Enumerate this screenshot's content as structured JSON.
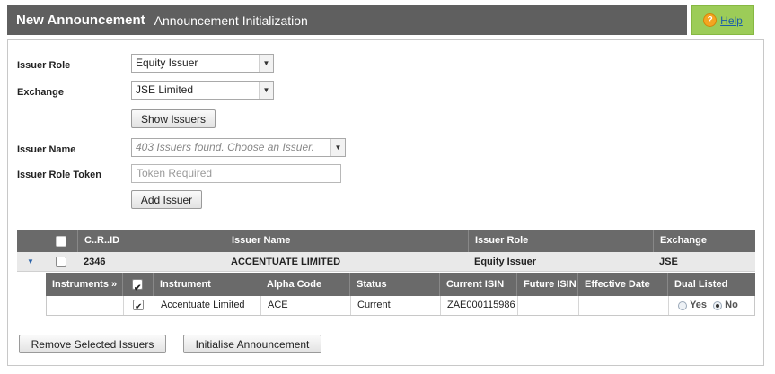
{
  "header": {
    "title": "New Announcement",
    "subtitle": "Announcement Initialization"
  },
  "help": {
    "label": "Help",
    "icon": "question-icon",
    "color": "#9ccc58"
  },
  "form": {
    "issuer_role_label": "Issuer Role",
    "issuer_role_value": "Equity Issuer",
    "exchange_label": "Exchange",
    "exchange_value": "JSE Limited",
    "show_issuers_label": "Show Issuers",
    "issuer_name_label": "Issuer Name",
    "issuer_name_placeholder": "403 Issuers found. Choose an Issuer.",
    "issuer_role_token_label": "Issuer Role Token",
    "issuer_role_token_placeholder": "Token Required",
    "add_issuer_label": "Add Issuer"
  },
  "grid": {
    "columns": [
      "C..R..ID",
      "Issuer Name",
      "Issuer Role",
      "Exchange"
    ],
    "row": {
      "crid": "2346",
      "issuer_name": "ACCENTUATE LIMITED",
      "issuer_role": "Equity Issuer",
      "exchange": "JSE"
    }
  },
  "subgrid": {
    "columns": [
      "Instruments »",
      "Instrument",
      "Alpha Code",
      "Status",
      "Current ISIN",
      "Future ISIN",
      "Effective Date",
      "Dual Listed"
    ],
    "row": {
      "instrument": "Accentuate Limited",
      "alpha_code": "ACE",
      "status": "Current",
      "current_isin": "ZAE000115986",
      "future_isin": "",
      "effective_date": "",
      "dual_yes": "Yes",
      "dual_no": "No"
    }
  },
  "actions": {
    "remove_label": "Remove Selected Issuers",
    "initialise_label": "Initialise Announcement"
  }
}
